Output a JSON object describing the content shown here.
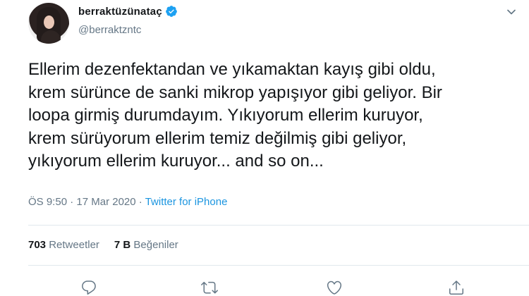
{
  "user": {
    "display_name": "berraktüzünataç",
    "handle": "@berraktzntc",
    "verified": true
  },
  "tweet": {
    "lines": [
      "Ellerim dezenfektandan ve yıkamaktan kayış gibi oldu,",
      "krem sürünce de sanki mikrop yapışıyor gibi geliyor. Bir",
      "loopa girmiş durumdayım. Yıkıyorum ellerim kuruyor,",
      "krem sürüyorum ellerim temiz değilmiş gibi geliyor,",
      "yıkıyorum ellerim kuruyor... and so on..."
    ]
  },
  "meta": {
    "time": "ÖS 9:50",
    "separator": " · ",
    "date": "17 Mar 2020",
    "source": "Twitter for iPhone"
  },
  "stats": {
    "retweets_count": "703",
    "retweets_label": "Retweetler",
    "likes_count": "7 B",
    "likes_label": "Beğeniler"
  },
  "colors": {
    "text": "#14171a",
    "secondary": "#657786",
    "link": "#1b95e0",
    "verified": "#1da1f2",
    "divider": "#e1e8ed"
  },
  "icons": [
    "verified-badge-icon",
    "chevron-down-icon",
    "reply-icon",
    "retweet-icon",
    "like-icon",
    "share-icon"
  ]
}
